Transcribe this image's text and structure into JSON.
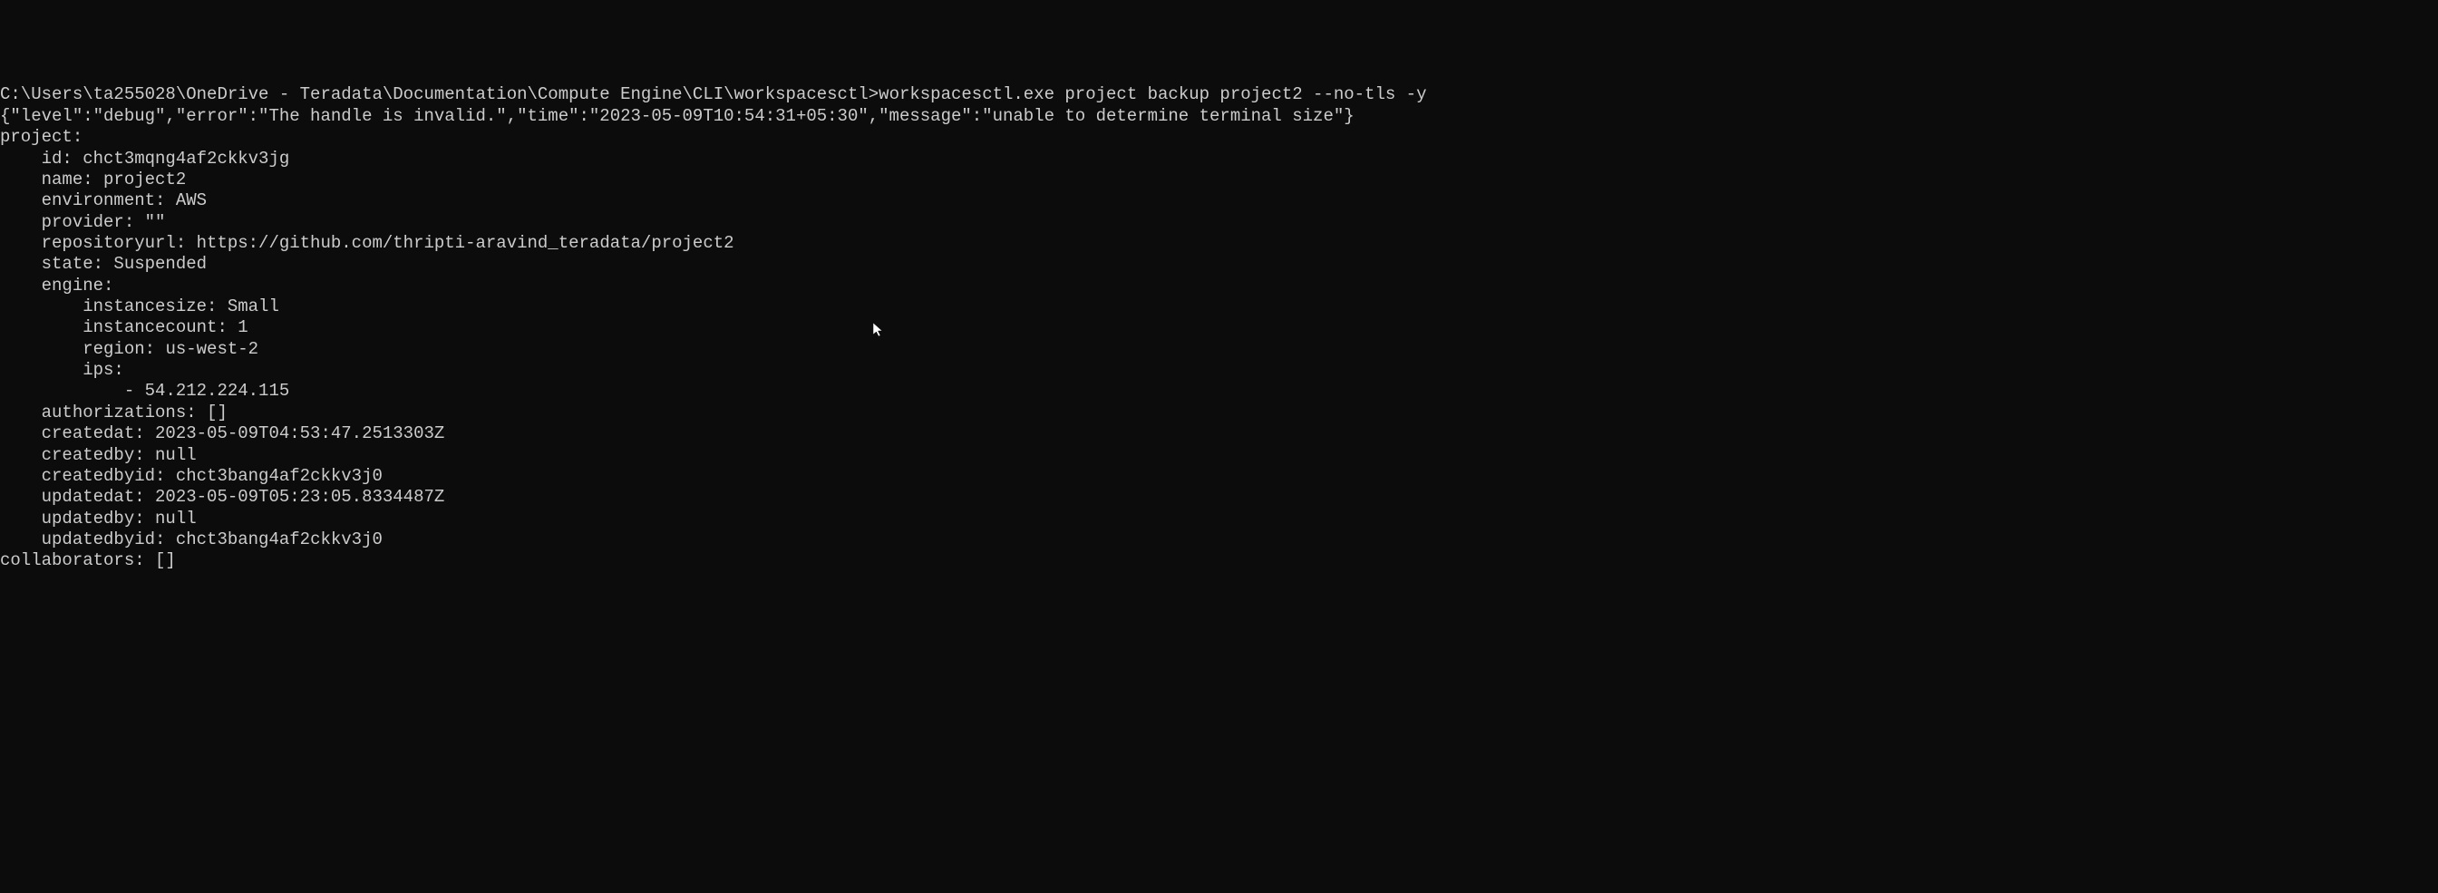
{
  "terminal": {
    "prompt_path": "C:\\Users\\ta255028\\OneDrive - Teradata\\Documentation\\Compute Engine\\CLI\\workspacesctl>",
    "command": "workspacesctl.exe project backup project2 --no-tls -y",
    "debug_line": "{\"level\":\"debug\",\"error\":\"The handle is invalid.\",\"time\":\"2023-05-09T10:54:31+05:30\",\"message\":\"unable to determine terminal size\"}",
    "output": {
      "project_header": "project:",
      "id_label": "    id: ",
      "id_value": "chct3mqng4af2ckkv3jg",
      "name_label": "    name: ",
      "name_value": "project2",
      "environment_label": "    environment: ",
      "environment_value": "AWS",
      "provider_label": "    provider: ",
      "provider_value": "\"\"",
      "repositoryurl_label": "    repositoryurl: ",
      "repositoryurl_value": "https://github.com/thripti-aravind_teradata/project2",
      "state_label": "    state: ",
      "state_value": "Suspended",
      "engine_header": "    engine:",
      "instancesize_label": "        instancesize: ",
      "instancesize_value": "Small",
      "instancecount_label": "        instancecount: ",
      "instancecount_value": "1",
      "region_label": "        region: ",
      "region_value": "us-west-2",
      "ips_header": "        ips:",
      "ips_item_prefix": "            - ",
      "ips_item_value": "54.212.224.115",
      "authorizations_label": "    authorizations: ",
      "authorizations_value": "[]",
      "createdat_label": "    createdat: ",
      "createdat_value": "2023-05-09T04:53:47.2513303Z",
      "createdby_label": "    createdby: ",
      "createdby_value": "null",
      "createdbyid_label": "    createdbyid: ",
      "createdbyid_value": "chct3bang4af2ckkv3j0",
      "updatedat_label": "    updatedat: ",
      "updatedat_value": "2023-05-09T05:23:05.8334487Z",
      "updatedby_label": "    updatedby: ",
      "updatedby_value": "null",
      "updatedbyid_label": "    updatedbyid: ",
      "updatedbyid_value": "chct3bang4af2ckkv3j0",
      "collaborators_label": "collaborators: ",
      "collaborators_value": "[]"
    }
  }
}
